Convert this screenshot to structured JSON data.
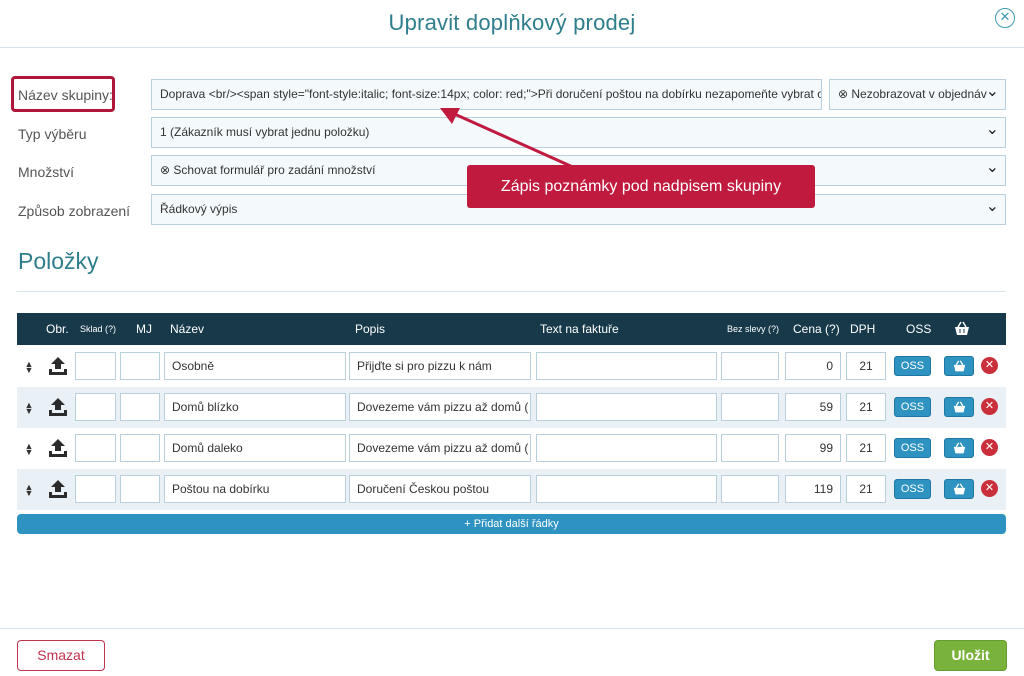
{
  "dialog": {
    "title": "Upravit doplňkový prodej",
    "close_icon": "close-icon"
  },
  "form": {
    "group_name_label": "Název skupiny:",
    "group_name_value": "Doprava <br/><span style=\"font-style:italic; font-size:14px; color: red;\">Při doručení poštou na dobírku nezapomeňte vybrat o",
    "display_select": "⊗ Nezobrazovat v objednáv",
    "selection_type_label": "Typ výběru",
    "selection_type_value": "1 (Zákazník musí vybrat jednu položku)",
    "quantity_label": "Množství",
    "quantity_value": "⊗ Schovat formulář pro zadání množství",
    "display_mode_label": "Způsob zobrazení",
    "display_mode_value": "Řádkový výpis"
  },
  "callout": {
    "text": "Zápis poznámky pod nadpisem skupiny",
    "color": "#c01a3f"
  },
  "items": {
    "section_title": "Položky",
    "columns": {
      "image": "Obr.",
      "stock": "Sklad (?)",
      "unit": "MJ",
      "name": "Název",
      "description": "Popis",
      "invoice_text": "Text na faktuře",
      "no_discount": "Bez slevy (?)",
      "price": "Cena (?)",
      "vat": "DPH",
      "oss": "OSS"
    },
    "rows": [
      {
        "name": "Osobně",
        "description": "Přijďte si pro pizzu k nám",
        "price": "0",
        "vat": "21",
        "oss_label": "OSS"
      },
      {
        "name": "Domů blízko",
        "description": "Dovezeme vám pizzu až domů (",
        "price": "59",
        "vat": "21",
        "oss_label": "OSS"
      },
      {
        "name": "Domů daleko",
        "description": "Dovezeme vám pizzu až domů (",
        "price": "99",
        "vat": "21",
        "oss_label": "OSS"
      },
      {
        "name": "Poštou na dobírku",
        "description": "Doručení Českou poštou",
        "price": "119",
        "vat": "21",
        "oss_label": "OSS"
      }
    ],
    "add_rows_label": "+ Přidat další řádky"
  },
  "footer": {
    "delete_label": "Smazat",
    "save_label": "Uložit"
  },
  "colors": {
    "accent": "#2e7e8c",
    "header_bg": "#17394a",
    "button_blue": "#2e93c1",
    "save_green": "#7ab33b",
    "danger": "#c0334d"
  }
}
